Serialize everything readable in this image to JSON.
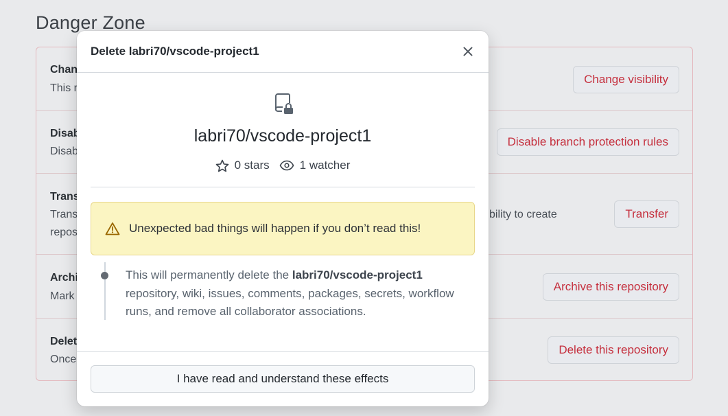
{
  "page": {
    "heading": "Danger Zone"
  },
  "danger_rows": [
    {
      "title": "Chan",
      "desc": "This r",
      "desc_extra": "",
      "button": "Change visibility"
    },
    {
      "title": "Disab",
      "desc": "Disab",
      "desc_extra": "",
      "button": "Disable branch protection rules"
    },
    {
      "title": "Trans",
      "desc": "Trans",
      "desc2": "repos",
      "desc_extra": "bility to create",
      "button": "Transfer"
    },
    {
      "title": "Archi",
      "desc": "Mark",
      "desc_extra": "",
      "button": "Archive this repository"
    },
    {
      "title": "Delet",
      "desc": "Once",
      "desc_extra": "",
      "button": "Delete this repository"
    }
  ],
  "modal": {
    "title": "Delete labri70/vscode-project1",
    "close_icon": "x-icon",
    "repo_icon": "repo-locked-icon",
    "repo_name": "labri70/vscode-project1",
    "stars": "0 stars",
    "watchers": "1 watcher",
    "warning": "Unexpected bad things will happen if you don’t read this!",
    "effect_prefix": "This will permanently delete the",
    "effect_repo": "labri70/vscode-project1",
    "effect_line2": "repository, wiki, issues, comments, packages, secrets, workflow",
    "effect_line3": "runs, and remove all collaborator associations.",
    "confirm_button": "I have read and understand these effects"
  },
  "colors": {
    "danger_text": "#c52f3d",
    "warning_bg": "#fbf5c2",
    "warning_icon": "#9a6700"
  }
}
